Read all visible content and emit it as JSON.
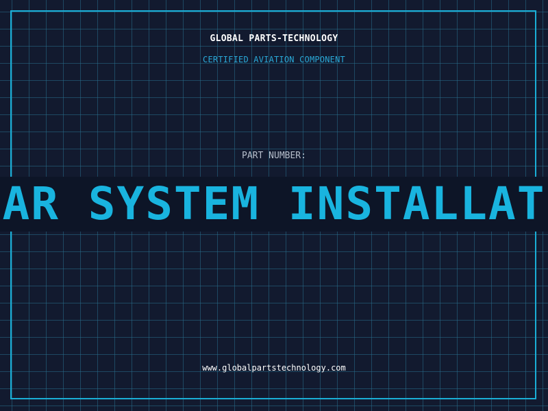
{
  "header": {
    "brand_name": "GLOBAL PARTS-TECHNOLOGY",
    "subtitle": "CERTIFIED AVIATION COMPONENT"
  },
  "part": {
    "label": "PART NUMBER:",
    "value": "RADAR SYSTEM INSTALLATION"
  },
  "footer": {
    "website": "www.globalpartstechnology.com"
  },
  "colors": {
    "background": "#121a2f",
    "grid": "#286e8c",
    "frame": "#1aaed6",
    "accent": "#19b4df",
    "banner_bg": "#0d1527",
    "primary_text": "#ffffff",
    "muted_text": "#b7bfcc"
  }
}
